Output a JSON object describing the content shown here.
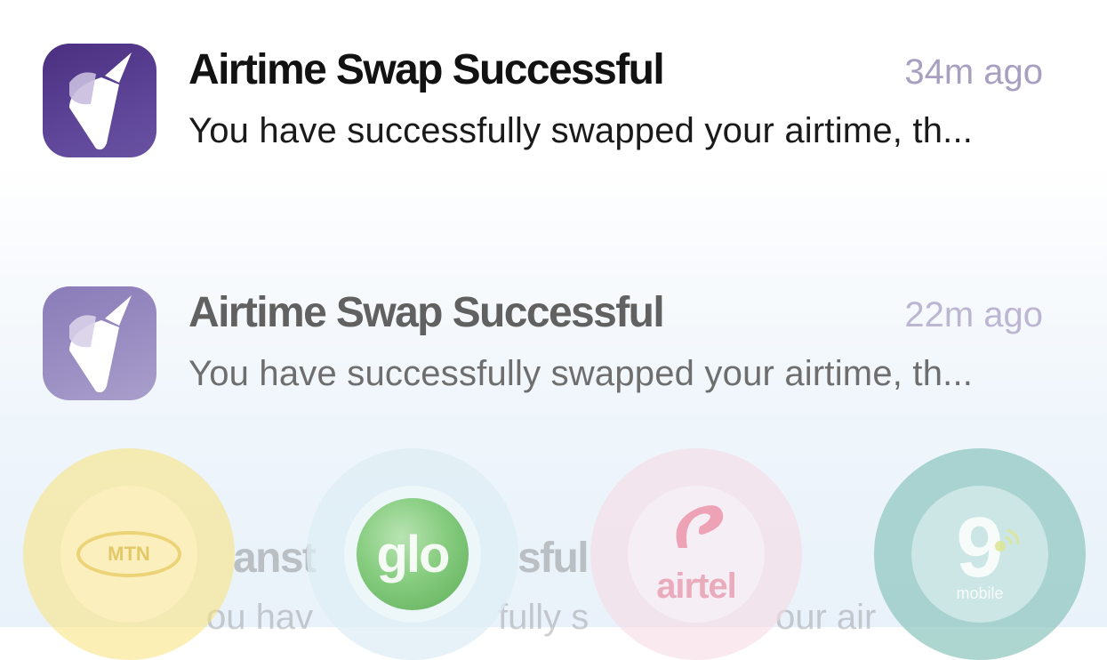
{
  "notifications": [
    {
      "title": "Airtime Swap Successful",
      "time": "34m ago",
      "body": "You have successfully swapped your airtime, th..."
    },
    {
      "title": "Airtime Swap Successful",
      "time": "22m ago",
      "body": "You have successfully swapped your airtime, th..."
    }
  ],
  "ghost_notification": {
    "title_fragment_1": "anst",
    "title_fragment_2": "sful",
    "body_fragment_1": "ou hav",
    "body_fragment_2": "fully s",
    "body_fragment_3": "our air"
  },
  "carriers": [
    {
      "name": "mtn",
      "logo_text": "MTN",
      "color": "#f5d94a"
    },
    {
      "name": "glo",
      "logo_text": "glo",
      "color": "#6cbf65"
    },
    {
      "name": "airtel",
      "logo_text": "airtel",
      "color": "#e8506f"
    },
    {
      "name": "9mobile",
      "logo_text": "mobile",
      "logo_numeral": "9",
      "color": "#5fb3a8"
    }
  ],
  "app_icon": "app-logo-icon",
  "colors": {
    "icon_primary": "#4b2f80",
    "time_text": "#a9a0c1",
    "title_text": "#121212"
  }
}
